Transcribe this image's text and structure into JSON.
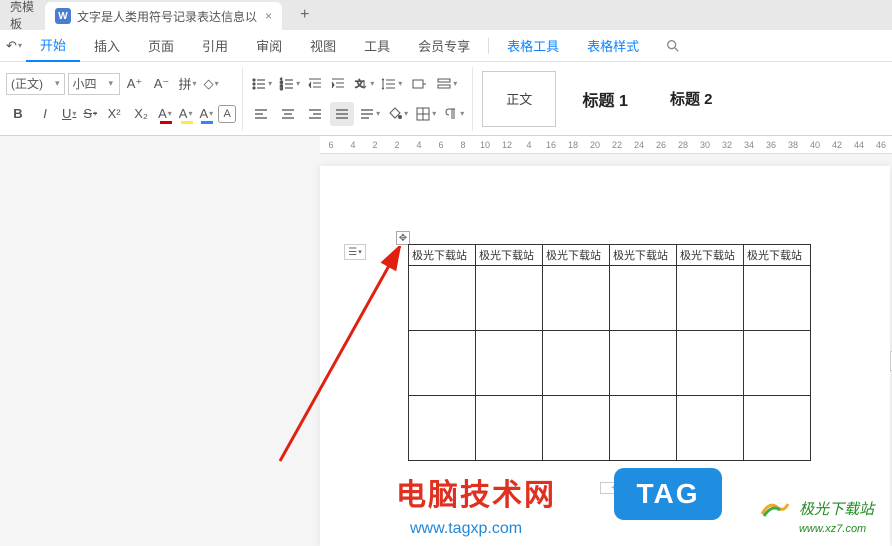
{
  "tabs": {
    "template_tab": "壳模板",
    "doc_icon": "W",
    "doc_title": "文字是人类用符号记录表达信息以",
    "close": "×",
    "add": "+"
  },
  "menu": {
    "back": "↶",
    "items": [
      "开始",
      "插入",
      "页面",
      "引用",
      "审阅",
      "视图",
      "工具",
      "会员专享"
    ],
    "table_tools": "表格工具",
    "table_style": "表格样式"
  },
  "toolbar": {
    "font_name": "(正文)",
    "font_size": "小四",
    "btns": {
      "bold": "B",
      "italic": "I",
      "underline": "U",
      "strike": "S",
      "super": "X²",
      "sub": "X₂",
      "font_color": "A",
      "highlight": "A",
      "grow": "A⁺",
      "shrink": "A⁻",
      "phonetic": "拼",
      "case": "A",
      "clear": "◇",
      "char_border": "A"
    },
    "styles": {
      "body": "正文",
      "h1": "标题 1",
      "h2": "标题 2"
    }
  },
  "ruler": [
    "6",
    "4",
    "2",
    "2",
    "4",
    "6",
    "8",
    "10",
    "12",
    "4",
    "16",
    "18",
    "20",
    "22",
    "24",
    "26",
    "28",
    "30",
    "32",
    "34",
    "36",
    "38",
    "40",
    "42",
    "44",
    "46"
  ],
  "table": {
    "header_cells": [
      "极光下载站",
      "极光下载站",
      "极光下载站",
      "极光下载站",
      "极光下载站",
      "极光下载站"
    ],
    "rows": 3
  },
  "watermark": {
    "site1": "电脑技术网",
    "url1": "www.tagxp.com",
    "tag": "TAG",
    "site2": "极光下载站",
    "url2": "www.xz7.com"
  },
  "handles": {
    "move": "✥",
    "para": "☰",
    "para_dd": "▾",
    "plus": "+"
  }
}
